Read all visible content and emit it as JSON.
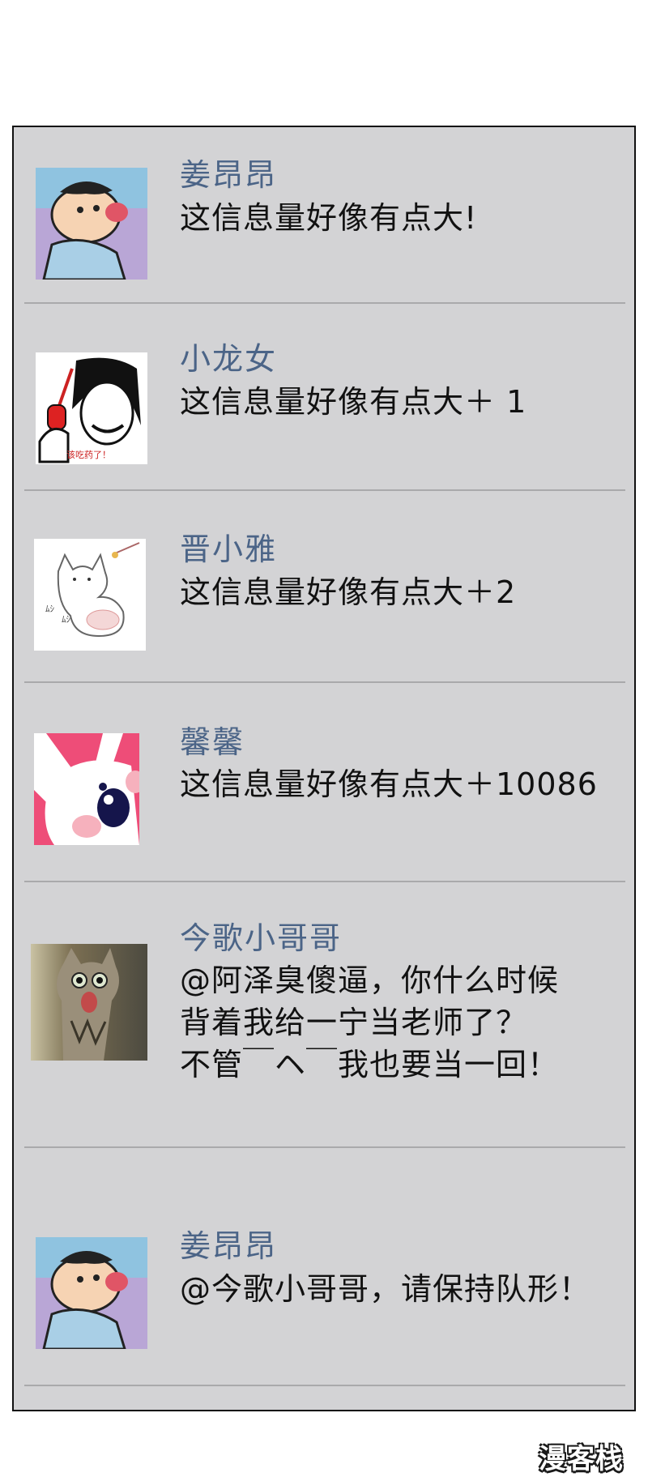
{
  "comments": [
    {
      "name": "姜昂昂",
      "lines": [
        "这信息量好像有点大!"
      ],
      "avatar": "cartoon-boy-icon"
    },
    {
      "name": "小龙女",
      "lines": [
        "这信息量好像有点大＋ 1"
      ],
      "avatar": "meme-face-icon",
      "avatar_caption": "该吃药了！"
    },
    {
      "name": "晋小雅",
      "lines": [
        "这信息量好像有点大＋2"
      ],
      "avatar": "cat-sketch-icon"
    },
    {
      "name": "馨馨",
      "lines": [
        "这信息量好像有点大＋10086"
      ],
      "avatar": "bunny-icon"
    },
    {
      "name": "今歌小哥哥",
      "lines": [
        "@阿泽臭傻逼，你什么时候",
        "背着我给一宁当老师了？",
        "不管￣ヘ￣我也要当一回！"
      ],
      "avatar": "cat-photo-icon"
    },
    {
      "name": "姜昂昂",
      "lines": [
        "@今歌小哥哥，请保持队形！"
      ],
      "avatar": "cartoon-boy-icon"
    }
  ],
  "watermark": "漫客栈",
  "colors": {
    "panel": "#d3d3d5",
    "name": "#4b6487",
    "text": "#111111"
  }
}
